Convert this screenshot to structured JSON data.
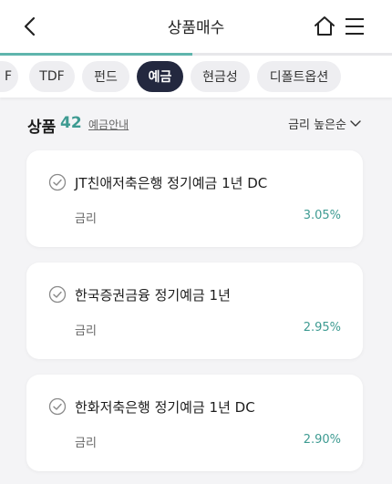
{
  "header": {
    "title": "상품매수"
  },
  "progress": {
    "fraction": 0.49
  },
  "tabs": [
    {
      "label": "F"
    },
    {
      "label": "TDF"
    },
    {
      "label": "펀드"
    },
    {
      "label": "예금"
    },
    {
      "label": "현금성"
    },
    {
      "label": "디폴트옵션"
    }
  ],
  "active_tab": "예금",
  "section": {
    "title": "상품",
    "count": "42",
    "link": "예금안내",
    "sort_label": "금리 높은순"
  },
  "products": [
    {
      "name": "JT친애저축은행 정기예금 1년 DC",
      "rate_label": "금리",
      "rate": "3.05%"
    },
    {
      "name": "한국증권금융 정기예금 1년",
      "rate_label": "금리",
      "rate": "2.95%"
    },
    {
      "name": "한화저축은행 정기예금 1년 DC",
      "rate_label": "금리",
      "rate": "2.90%"
    }
  ],
  "colors": {
    "accent": "#3e9b92",
    "active_tab_bg": "#23283f",
    "tab_bg": "#eeeef1",
    "page_bg": "#f4f4f6"
  },
  "icons": [
    "chevron-left-icon",
    "home-icon",
    "hamburger-menu-icon",
    "chevron-down-icon",
    "check-circle-icon"
  ]
}
